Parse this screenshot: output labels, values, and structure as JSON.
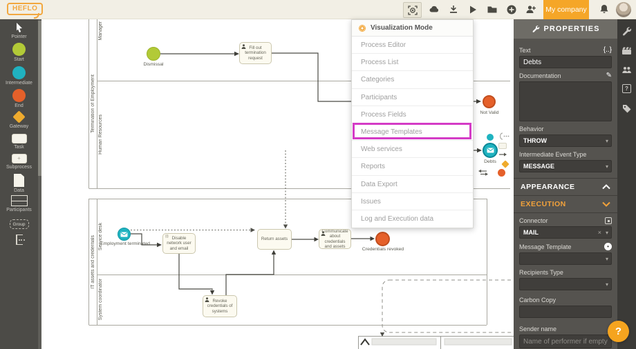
{
  "topbar": {
    "logo": "HEFLO",
    "company_button": "My company"
  },
  "palette": {
    "items": [
      {
        "label": "Pointer"
      },
      {
        "label": "Start"
      },
      {
        "label": "Intermediate"
      },
      {
        "label": "End"
      },
      {
        "label": "Gateway"
      },
      {
        "label": "Task"
      },
      {
        "label": "Subprocess"
      },
      {
        "label": "Data"
      },
      {
        "label": "Participants"
      },
      {
        "label": "Group"
      }
    ]
  },
  "menu": {
    "title": "Visualization Mode",
    "items": [
      "Process Editor",
      "Process List",
      "Categories",
      "Participants",
      "Process Fields",
      "Message Templates",
      "Web services",
      "Reports",
      "Data Export",
      "Issues",
      "Log and Execution data"
    ],
    "highlighted_item": "Message Templates"
  },
  "canvas": {
    "pools": [
      {
        "name": "Termination of Employment",
        "lanes": [
          "Manager",
          "Human Resources"
        ]
      },
      {
        "name": "IT assets and credentials",
        "lanes": [
          "Service desk",
          "System coordinator"
        ]
      }
    ],
    "nodes": {
      "dismissal": "Dismissal",
      "fill_out_task": "Fill out termination request",
      "not_valid": "Not Valid",
      "debts": "Debts",
      "employment_terminated": "Employment terminated",
      "disable_task": "Disable network user and email",
      "disable_marker": "{i}",
      "return_assets_task": "Return assets",
      "communicate_task": "Communicate about credentials and assets",
      "credentials_revoked": "Credentials revoked",
      "revoke_task": "Revoke credentials of systems"
    }
  },
  "properties": {
    "title": "PROPERTIES",
    "text_label": "Text",
    "text_value": "Debts",
    "documentation_label": "Documentation",
    "behavior_label": "Behavior",
    "behavior_value": "THROW",
    "event_type_label": "Intermediate Event Type",
    "event_type_value": "MESSAGE",
    "appearance_section": "APPEARANCE",
    "execution_section": "EXECUTION",
    "connector_label": "Connector",
    "connector_value": "MAIL",
    "message_template_label": "Message Template",
    "recipients_type_label": "Recipients Type",
    "carbon_copy_label": "Carbon Copy",
    "sender_name_label": "Sender name",
    "sender_name_placeholder": "Name of performer if empty"
  },
  "help_button": "?",
  "colors": {
    "accent_orange": "#f5a623",
    "highlight_magenta": "#d43bc6",
    "start_green": "#b2ca37",
    "intermediate_teal": "#20b2c0",
    "end_orange": "#e5602a",
    "gateway_amber": "#efab2e"
  }
}
